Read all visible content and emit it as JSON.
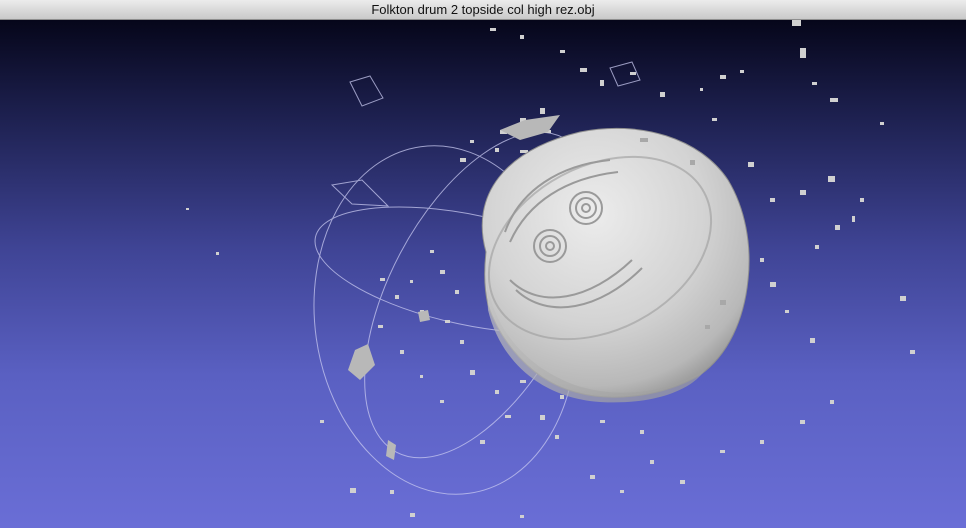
{
  "window": {
    "title": "Folkton drum 2 topside col high rez.obj"
  },
  "viewport": {
    "background_top": "#06061a",
    "background_bottom": "#6a6ed6",
    "mesh_color": "#d7d7d7",
    "trackball_color": "#c8c9f0"
  }
}
